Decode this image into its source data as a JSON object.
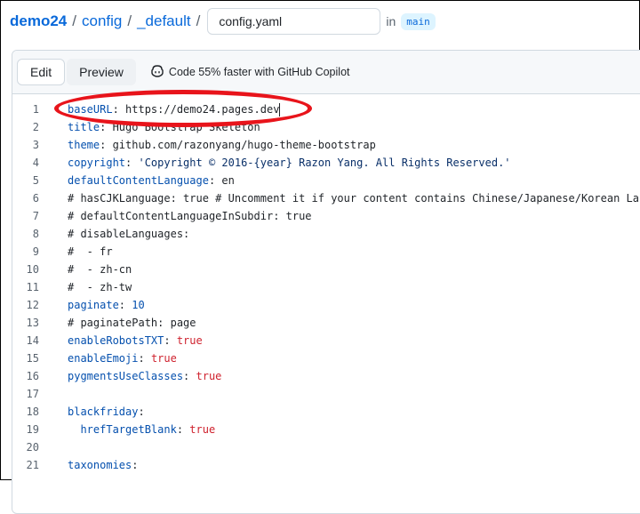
{
  "breadcrumb": {
    "repo": "demo24",
    "sep1": "/",
    "folder1": "config",
    "sep2": "/",
    "folder2": "_default",
    "sep3": "/",
    "filename": "config.yaml",
    "in_label": "in",
    "branch": "main"
  },
  "editor": {
    "tabs": [
      {
        "label": "Edit",
        "active": true
      },
      {
        "label": "Preview",
        "active": false
      }
    ],
    "copilot_text": "Code 55% faster with GitHub Copilot",
    "lines": [
      {
        "num": "1",
        "key": "baseURL",
        "punct": ": ",
        "value": "https://demo24.pages.dev",
        "vtype": "plain"
      },
      {
        "num": "2",
        "key": "title",
        "punct": ": ",
        "value": "Hugo Bootstrap Skeleton",
        "vtype": "plain"
      },
      {
        "num": "3",
        "key": "theme",
        "punct": ": ",
        "value": "github.com/razonyang/hugo-theme-bootstrap",
        "vtype": "plain"
      },
      {
        "num": "4",
        "key": "copyright",
        "punct": ": ",
        "value": "'Copyright © 2016-{year} Razon Yang. All Rights Reserved.'",
        "vtype": "string"
      },
      {
        "num": "5",
        "key": "defaultContentLanguage",
        "punct": ": ",
        "value": "en",
        "vtype": "plain"
      },
      {
        "num": "6",
        "comment": "# hasCJKLanguage: true # Uncomment it if your content contains Chinese/Japanese/Korean Langu"
      },
      {
        "num": "7",
        "comment": "# defaultContentLanguageInSubdir: true"
      },
      {
        "num": "8",
        "comment": "# disableLanguages:"
      },
      {
        "num": "9",
        "comment": "#  - fr"
      },
      {
        "num": "10",
        "comment": "#  - zh-cn"
      },
      {
        "num": "11",
        "comment": "#  - zh-tw"
      },
      {
        "num": "12",
        "key": "paginate",
        "punct": ": ",
        "value": "10",
        "vtype": "number"
      },
      {
        "num": "13",
        "comment": "# paginatePath: page"
      },
      {
        "num": "14",
        "key": "enableRobotsTXT",
        "punct": ": ",
        "value": "true",
        "vtype": "bool"
      },
      {
        "num": "15",
        "key": "enableEmoji",
        "punct": ": ",
        "value": "true",
        "vtype": "bool"
      },
      {
        "num": "16",
        "key": "pygmentsUseClasses",
        "punct": ": ",
        "value": "true",
        "vtype": "bool"
      },
      {
        "num": "17",
        "blank": true
      },
      {
        "num": "18",
        "key": "blackfriday",
        "punct": ":",
        "value": "",
        "vtype": "plain"
      },
      {
        "num": "19",
        "indent": "  ",
        "key": "hrefTargetBlank",
        "punct": ": ",
        "value": "true",
        "vtype": "bool"
      },
      {
        "num": "20",
        "blank": true
      },
      {
        "num": "21",
        "key": "taxonomies",
        "punct": ":",
        "value": "",
        "vtype": "plain"
      }
    ]
  },
  "colors": {
    "link": "#0969da",
    "key": "#0550ae",
    "bool": "#cf222e",
    "string": "#0a3069",
    "annotation": "#e8141b"
  },
  "icons": [
    "copilot-icon"
  ]
}
